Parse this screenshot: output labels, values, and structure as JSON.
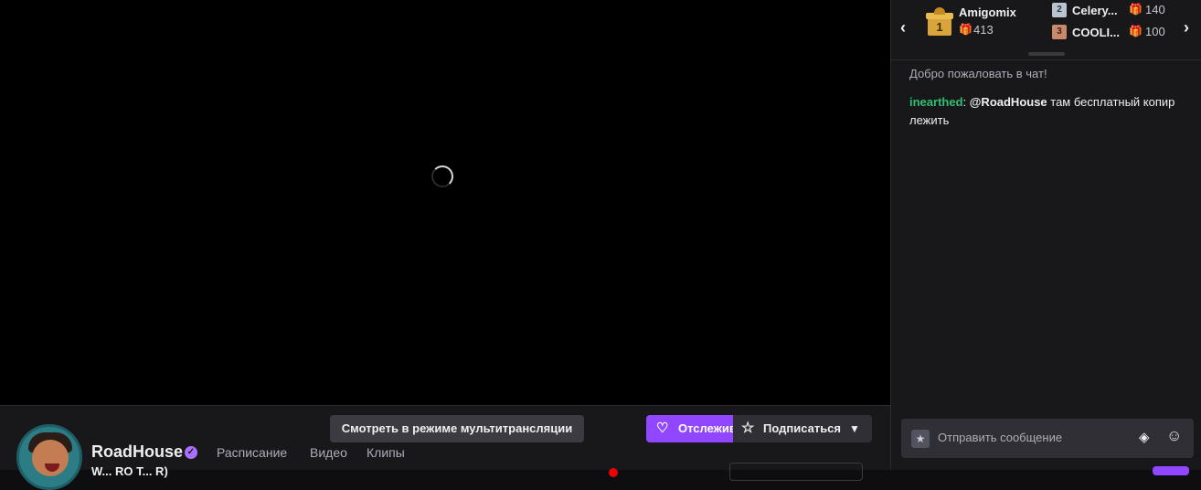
{
  "player": {
    "status": "loading"
  },
  "channel": {
    "name": "RoadHouse",
    "verified_icon": "verified-check-icon",
    "tabs": [
      "Расписание",
      "Видео",
      "Клипы"
    ],
    "title": "W... RO T... R)"
  },
  "actions": {
    "multiview": "Смотреть в режиме мультитрансляции",
    "follow": "Отслеживать",
    "subscribe": "Подписаться"
  },
  "leaderboard": {
    "top": {
      "rank": "1",
      "name": "Amigomix",
      "count": "413"
    },
    "second": {
      "rank": "2",
      "name": "Celery...",
      "count": "140"
    },
    "third": {
      "rank": "3",
      "name": "COOLI...",
      "count": "100"
    }
  },
  "chat": {
    "welcome": "Добро пожаловать в чат!",
    "messages": [
      {
        "user": "inearthed",
        "mention": "@RoadHouse",
        "text": " там бесплатный копир лежить"
      }
    ],
    "input_placeholder": "Отправить сообщение"
  },
  "colors": {
    "accent": "#9147ff",
    "gift_green": "#2fbf71",
    "gift_orange": "#f0913a"
  }
}
